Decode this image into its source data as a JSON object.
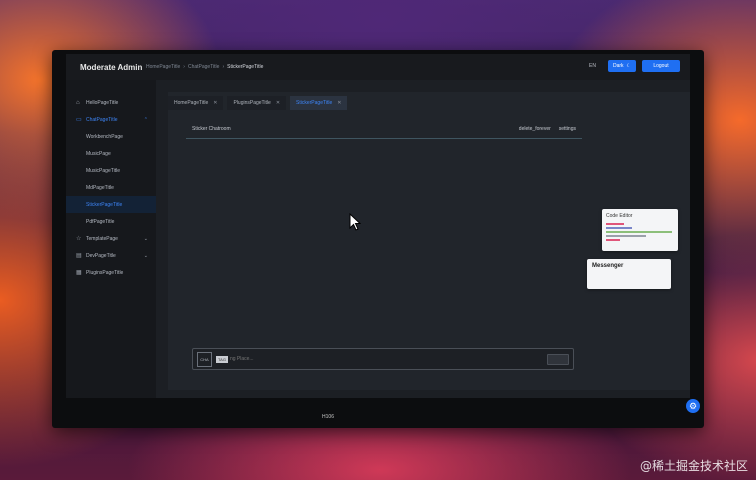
{
  "app": {
    "title": "Moderate Admin"
  },
  "breadcrumb": [
    "HomePageTitle",
    "ChatPageTitle",
    "StickerPageTitle"
  ],
  "header": {
    "lang": "EN",
    "dark_label": "Dark",
    "logout_label": "Logout"
  },
  "sidebar": {
    "items": [
      {
        "label": "HelloPageTitle",
        "icon": "home-icon"
      },
      {
        "label": "ChatPageTitle",
        "icon": "chat-icon"
      },
      {
        "label": "WorkbenchPage"
      },
      {
        "label": "MusicPage"
      },
      {
        "label": "MusicPageTitle"
      },
      {
        "label": "MdPageTitle"
      },
      {
        "label": "StickerPageTitle"
      },
      {
        "label": "PdfPageTitle"
      },
      {
        "label": "TemplatePage",
        "icon": "star-icon"
      },
      {
        "label": "DevPageTitle",
        "icon": "document-icon"
      },
      {
        "label": "PluginsPageTitle",
        "icon": "grid-icon"
      }
    ]
  },
  "tabs": [
    {
      "label": "HomePageTitle"
    },
    {
      "label": "PluginsPageTitle"
    },
    {
      "label": "StickerPageTitle"
    }
  ],
  "panel": {
    "title": "Sticker Chatroom",
    "right_a": "delete_forever",
    "right_b": "settings"
  },
  "chat": {
    "avatar_text": "CHA",
    "tag": "TAG",
    "placeholder": "ng Place..."
  },
  "windows": {
    "code_editor": "Code Editor",
    "messenger": "Messenger"
  },
  "footer": {
    "monitor_logo": "H106"
  },
  "watermark": "@稀土掘金技术社区",
  "colors": {
    "accent": "#1f6ff2",
    "active_bg": "#132236"
  }
}
